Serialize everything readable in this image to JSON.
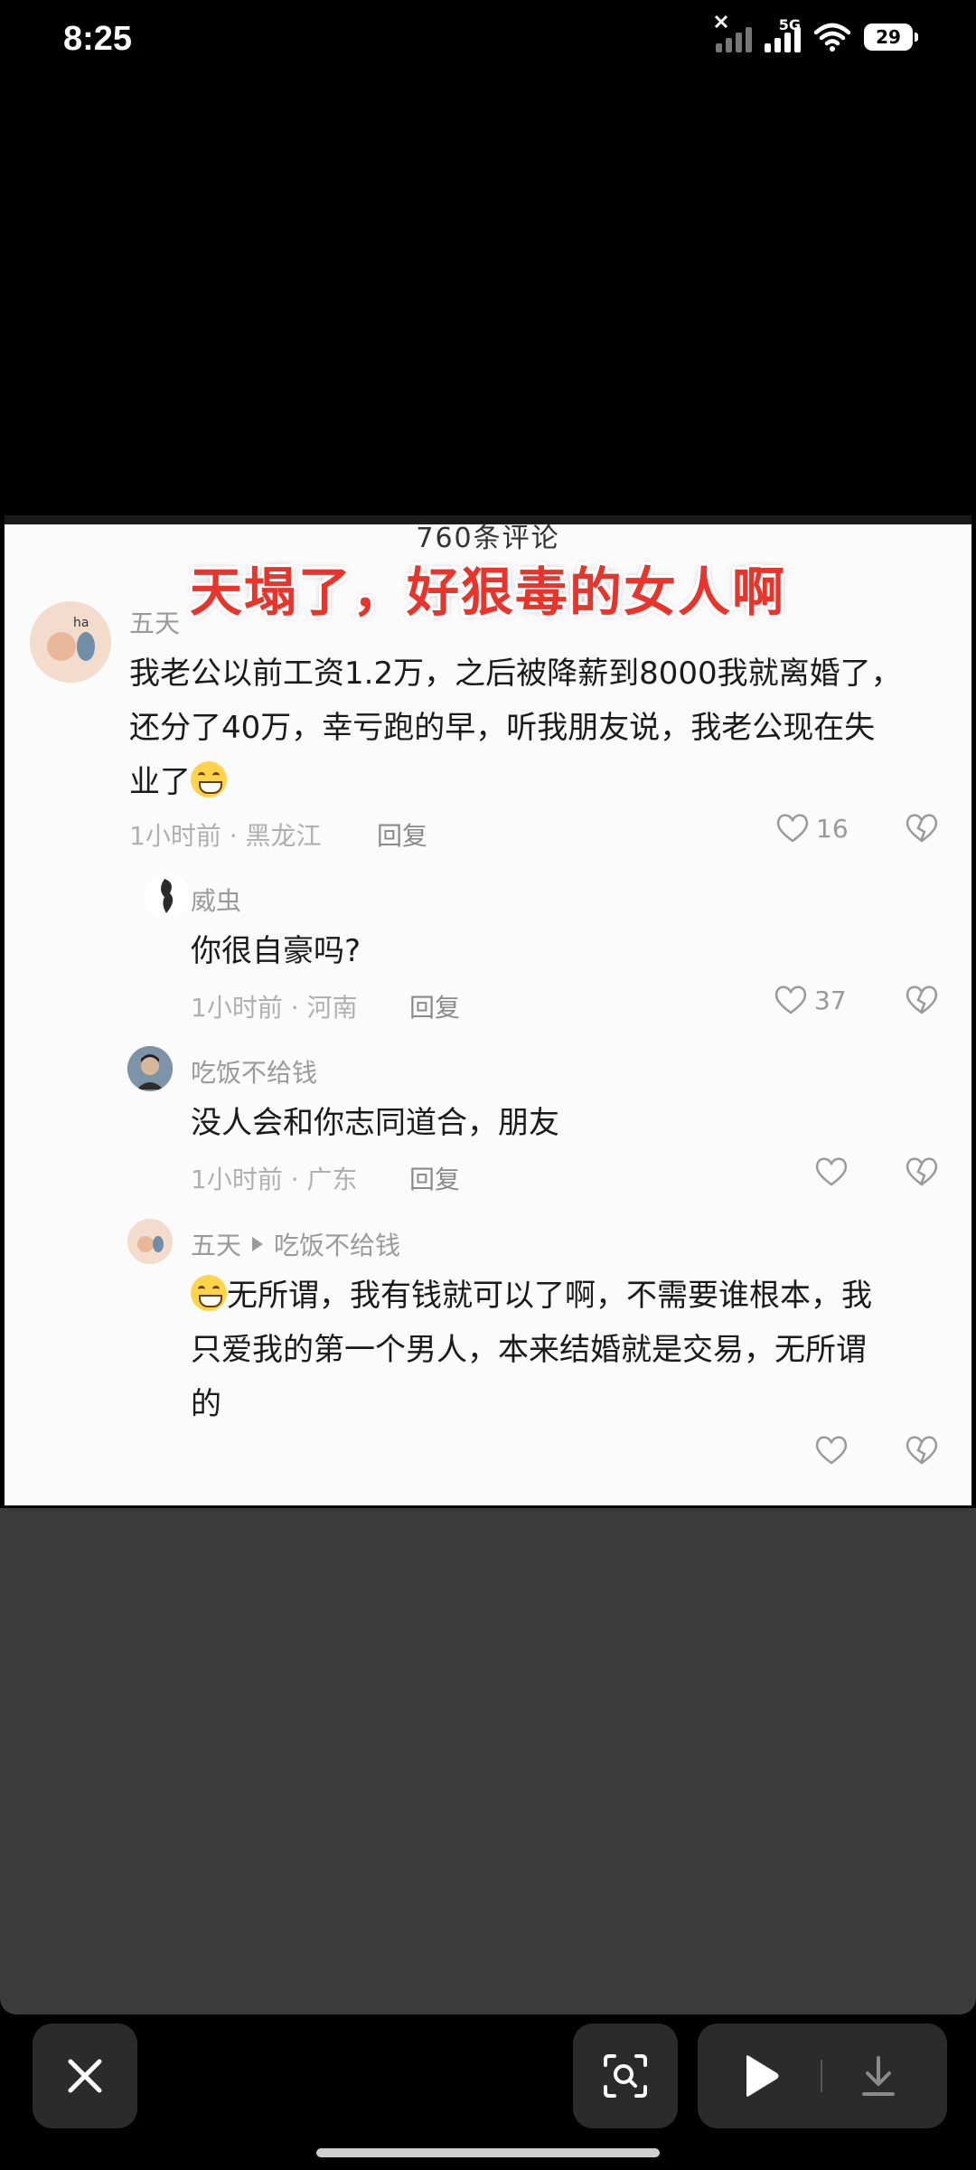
{
  "status_bar": {
    "time": "8:25",
    "network": "5G",
    "battery": "29"
  },
  "media": {
    "header_partial": "760条评论",
    "overlay_title": "天塌了，好狠毒的女人啊",
    "comments": [
      {
        "username": "五天",
        "text_line1": "我老公以前工资1.2万，之后被降薪到8000我就离婚了，",
        "text_line2": "还分了40万，幸亏跑的早，听我朋友说，我老公现在失",
        "text_line3": "业了",
        "time_location": "1小时前 · 黑龙江",
        "reply_label": "回复",
        "like_count": "16"
      },
      {
        "username": "威虫",
        "text": "你很自豪吗?",
        "time_location": "1小时前 · 河南",
        "reply_label": "回复",
        "like_count": "37"
      },
      {
        "username": "吃饭不给钱",
        "text": "没人会和你志同道合，朋友",
        "time_location": "1小时前 · 广东",
        "reply_label": "回复",
        "like_count": ""
      },
      {
        "username": "五天",
        "reply_to": "吃饭不给钱",
        "text_line1": "无所谓，我有钱就可以了啊，不需要谁根本，我",
        "text_line2": "只爱我的第一个男人，本来结婚就是交易，无所谓",
        "text_line3": "的"
      }
    ]
  },
  "bottom_bar": {
    "close_icon": "close-icon",
    "lens_icon": "lens-scan-icon",
    "play_icon": "play-icon",
    "download_icon": "download-icon"
  }
}
